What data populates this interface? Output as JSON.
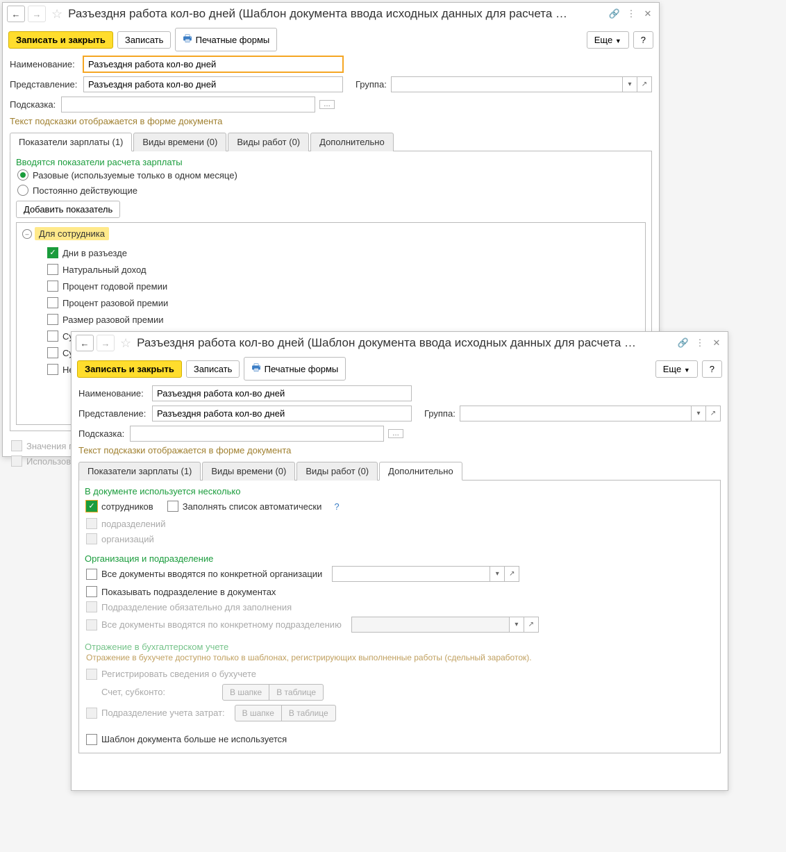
{
  "w1": {
    "title": "Разъездня работа кол-во дней (Шаблон документа ввода исходных данных для расчета …",
    "btn_save_close": "Записать и закрыть",
    "btn_save": "Записать",
    "btn_print": "Печатные формы",
    "btn_more": "Еще",
    "btn_help": "?",
    "lbl_name": "Наименование:",
    "val_name": "Разъездня работа кол-во дней",
    "lbl_repr": "Представление:",
    "val_repr": "Разъездня работа кол-во дней",
    "lbl_group": "Группа:",
    "lbl_hint": "Подсказка:",
    "hint_text": "Текст подсказки отображается в форме документа",
    "tabs": [
      "Показатели зарплаты (1)",
      "Виды времени (0)",
      "Виды работ (0)",
      "Дополнительно"
    ],
    "sec_title": "Вводятся показатели расчета зарплаты",
    "radio1": "Разовые (используемые только в одном месяце)",
    "radio2": "Постоянно действующие",
    "btn_add": "Добавить показатель",
    "tree_title": "Для сотрудника",
    "tree": [
      {
        "label": "Дни в разъезде",
        "on": true
      },
      {
        "label": "Натуральный доход",
        "on": false
      },
      {
        "label": "Процент годовой премии",
        "on": false
      },
      {
        "label": "Процент разовой премии",
        "on": false
      },
      {
        "label": "Размер разовой премии",
        "on": false
      },
      {
        "label": "Су",
        "on": false
      },
      {
        "label": "Су",
        "on": false
      },
      {
        "label": "Не",
        "on": false
      }
    ],
    "chk_values": "Значения п",
    "chk_use": "Использова"
  },
  "w2": {
    "title": "Разъездня работа кол-во дней (Шаблон документа ввода исходных данных для расчета …",
    "btn_save_close": "Записать и закрыть",
    "btn_save": "Записать",
    "btn_print": "Печатные формы",
    "btn_more": "Еще",
    "btn_help": "?",
    "lbl_name": "Наименование:",
    "val_name": "Разъездня работа кол-во дней",
    "lbl_repr": "Представление:",
    "val_repr": "Разъездня работа кол-во дней",
    "lbl_group": "Группа:",
    "lbl_hint": "Подсказка:",
    "hint_text": "Текст подсказки отображается в форме документа",
    "tabs": [
      "Показатели зарплаты (1)",
      "Виды времени (0)",
      "Виды работ (0)",
      "Дополнительно"
    ],
    "sec1_title": "В документе используется несколько",
    "chk_employees": "сотрудников",
    "chk_autofill": "Заполнять список автоматически",
    "chk_depts": "подразделений",
    "chk_orgs": "организаций",
    "sec2_title": "Организация и подразделение",
    "chk_all_org": "Все документы вводятся по конкретной организации",
    "chk_show_dept": "Показывать подразделение в документах",
    "chk_dept_req": "Подразделение обязательно для заполнения",
    "chk_all_dept": "Все документы вводятся по конкретному подразделению",
    "sec3_title": "Отражение в бухгалтерском учете",
    "sec3_hint": "Отражение в бухучете доступно только в шаблонах, регистрирующих выполненные работы (сдельный заработок).",
    "chk_reg": "Регистрировать сведения о бухучете",
    "lbl_account": "Счет, субконто:",
    "lbl_dept_cost": "Подразделение учета затрат:",
    "tog1": "В шапке",
    "tog2": "В таблице",
    "chk_unused": "Шаблон документа больше не используется"
  }
}
